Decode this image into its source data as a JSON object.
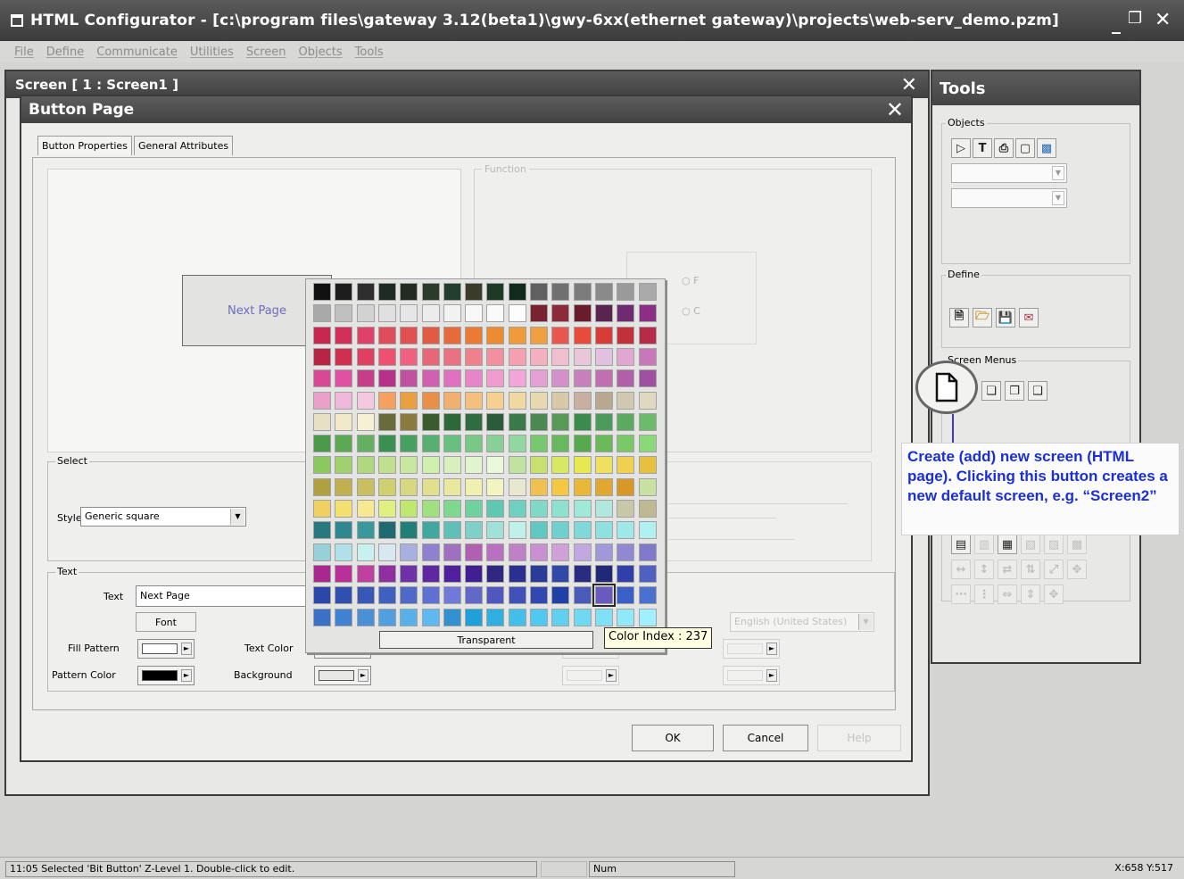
{
  "app": {
    "title": "HTML Configurator - [c:\\program files\\gateway 3.12(beta1)\\gwy-6xx(ethernet gateway)\\projects\\web-serv_demo.pzm]"
  },
  "menu": [
    "File",
    "Define",
    "Communicate",
    "Utilities",
    "Screen",
    "Objects",
    "Tools"
  ],
  "screen_window": {
    "title": "Screen [ 1 : Screen1 ]"
  },
  "dialog": {
    "title": "Button Page",
    "tabs": [
      "Button Properties",
      "General Attributes"
    ],
    "preview_button_text": "Next Page",
    "right_group_label": "Function",
    "select_group": {
      "label": "Select",
      "style_label": "Style",
      "style_value": "Generic square"
    },
    "text_group": {
      "label": "Text",
      "text_label": "Text",
      "text_value": "Next Page",
      "font_button": "Font",
      "fill_pattern_label": "Fill Pattern",
      "pattern_color_label": "Pattern Color",
      "text_color_label": "Text Color",
      "background_label": "Background",
      "language_value": "English (United States)"
    },
    "buttons": {
      "ok": "OK",
      "cancel": "Cancel",
      "help": "Help"
    }
  },
  "palette": {
    "transparent_label": "Transparent",
    "tooltip": "Color Index : 237",
    "selected_row": 14,
    "selected_col": 13,
    "rows": [
      [
        "#111111",
        "#1d1d1d",
        "#2e2e2e",
        "#1e2a22",
        "#232b22",
        "#2c3a2b",
        "#213d2b",
        "#3c3b2a",
        "#1d3a26",
        "#102a1c",
        "#606060",
        "#707070",
        "#7c7c7c",
        "#8a8a8a",
        "#9a9a9a",
        "#aaaaaa"
      ],
      [
        "#a9a9a9",
        "#c0c0c0",
        "#d2d2d2",
        "#e0e0e0",
        "#e6e6e6",
        "#ececec",
        "#f2f2f2",
        "#f8f8f8",
        "#fafafa",
        "#fdfdfd",
        "#7a2230",
        "#8c2a3c",
        "#6b1c2b",
        "#5a2450",
        "#6e2b72",
        "#8a2e86"
      ],
      [
        "#c8284e",
        "#d2305a",
        "#e0406a",
        "#e04c5a",
        "#e05050",
        "#e05a44",
        "#e66a3a",
        "#ea7a34",
        "#ee8a30",
        "#f09a3a",
        "#f0a040",
        "#e8564e",
        "#e84a3c",
        "#d83a38",
        "#c2303c",
        "#b82a4a"
      ],
      [
        "#b82444",
        "#d03050",
        "#e04060",
        "#f05070",
        "#f06080",
        "#e66878",
        "#e87080",
        "#ee8090",
        "#f290a0",
        "#f4a0b0",
        "#f4b0c0",
        "#f0c0d0",
        "#e8c8d8",
        "#e2c0e0",
        "#e0a8d0",
        "#c878b8"
      ],
      [
        "#d84894",
        "#e050a0",
        "#c83c8c",
        "#b8308a",
        "#c050a0",
        "#d060b0",
        "#e070c0",
        "#e884c8",
        "#f09ad0",
        "#f2a6d8",
        "#e4a0d4",
        "#d490c8",
        "#c880bc",
        "#c070b0",
        "#b060a8",
        "#a050a0"
      ],
      [
        "#e8a0c8",
        "#f0b8d8",
        "#f4c8e0",
        "#f6a060",
        "#e8a040",
        "#e69048",
        "#f0b070",
        "#f4c080",
        "#f6d090",
        "#f0d8a0",
        "#e8d8b0",
        "#d8c8a8",
        "#c8b0a0",
        "#b8a890",
        "#d0c8b0",
        "#e0d8c0"
      ],
      [
        "#e8e0c4",
        "#f0e8c8",
        "#f6f0d4",
        "#6a6a3a",
        "#8a7a40",
        "#3a5a30",
        "#2c6838",
        "#306c40",
        "#2a5c3a",
        "#3a7a48",
        "#4a8a50",
        "#5a9a58",
        "#3c8a4c",
        "#4c9a5c",
        "#5caa60",
        "#6cba6c"
      ],
      [
        "#4a9a4a",
        "#5aaa54",
        "#64b060",
        "#3a9050",
        "#48a060",
        "#58b070",
        "#68c080",
        "#78c888",
        "#88d098",
        "#90d8a0",
        "#78c870",
        "#68b860",
        "#58a850",
        "#6ab858",
        "#7ac868",
        "#8ad878"
      ],
      [
        "#8ac860",
        "#a0d070",
        "#b0d880",
        "#c0e090",
        "#c8e8a0",
        "#d0f0b0",
        "#d8f0c0",
        "#e0f4d0",
        "#e8f8d8",
        "#c0e4a0",
        "#c8e070",
        "#d8e860",
        "#e8e850",
        "#f0e060",
        "#f0d050",
        "#e8c040"
      ],
      [
        "#b0a040",
        "#c0b050",
        "#c8c060",
        "#d0d070",
        "#d8d880",
        "#e0e090",
        "#e8e8a0",
        "#f0f0b0",
        "#f4f4c0",
        "#e8e8d0",
        "#f0c050",
        "#f4c840",
        "#e8b838",
        "#e0a830",
        "#d89828",
        "#c8e0a0"
      ],
      [
        "#f0d060",
        "#f4e070",
        "#f8e890",
        "#e0f080",
        "#c0e870",
        "#a0e080",
        "#80d890",
        "#70d0a0",
        "#60c8b0",
        "#70d0c0",
        "#80d8c8",
        "#90e0d0",
        "#a0e8d8",
        "#b0e8e0",
        "#c8c8a8",
        "#c0b890"
      ],
      [
        "#287880",
        "#30888e",
        "#38989c",
        "#1e6a70",
        "#208078",
        "#40a8a0",
        "#60c0b8",
        "#80d0c8",
        "#a0e0d8",
        "#c0f0e8",
        "#60c8c0",
        "#70d0d0",
        "#80d8d8",
        "#90e0e0",
        "#a0e8e8",
        "#b0f0f0"
      ],
      [
        "#98d0d8",
        "#b0e0e8",
        "#c8f0f0",
        "#d8e8f0",
        "#a8b0e0",
        "#9080d0",
        "#a070c0",
        "#b060b0",
        "#b870c0",
        "#c080c8",
        "#c890d0",
        "#d0a0d8",
        "#c0a8e0",
        "#a098d8",
        "#9088d0",
        "#8078c8"
      ],
      [
        "#a82890",
        "#b83098",
        "#c040a0",
        "#9030a0",
        "#7030a8",
        "#6028a0",
        "#50209c",
        "#402090",
        "#302880",
        "#2a3090",
        "#283c98",
        "#3048a8",
        "#2a2c80",
        "#202878",
        "#3040a8",
        "#5060c0"
      ],
      [
        "#2a48a8",
        "#3050b0",
        "#3858b8",
        "#4060c0",
        "#5068c8",
        "#6070d0",
        "#7078d8",
        "#6068c8",
        "#5058c0",
        "#4050b8",
        "#3048b0",
        "#2040a8",
        "#4a5ab8",
        "#6a5ac0",
        "#3a60c8",
        "#4a70d0"
      ],
      [
        "#3a70c8",
        "#4280d0",
        "#4a90d8",
        "#50a0e0",
        "#58b0e8",
        "#60b8f0",
        "#3090d0",
        "#20a0d8",
        "#30b0e0",
        "#40c0e8",
        "#50c8f0",
        "#60d0f0",
        "#70d8f0",
        "#80e0f8",
        "#90e8f8",
        "#a0f0ff"
      ]
    ]
  },
  "tools": {
    "title": "Tools",
    "objects_label": "Objects",
    "define_label": "Define",
    "screen_menus_label": "Screen Menus"
  },
  "annotation": {
    "text": "Create (add) new screen (HTML page). Clicking this button creates a new default screen, e.g. “Screen2”"
  },
  "status": {
    "message": "11:05   Selected 'Bit Button'  Z-Level 1.  Double-click to edit.",
    "num": "Num",
    "coords": "X:658  Y:517"
  }
}
